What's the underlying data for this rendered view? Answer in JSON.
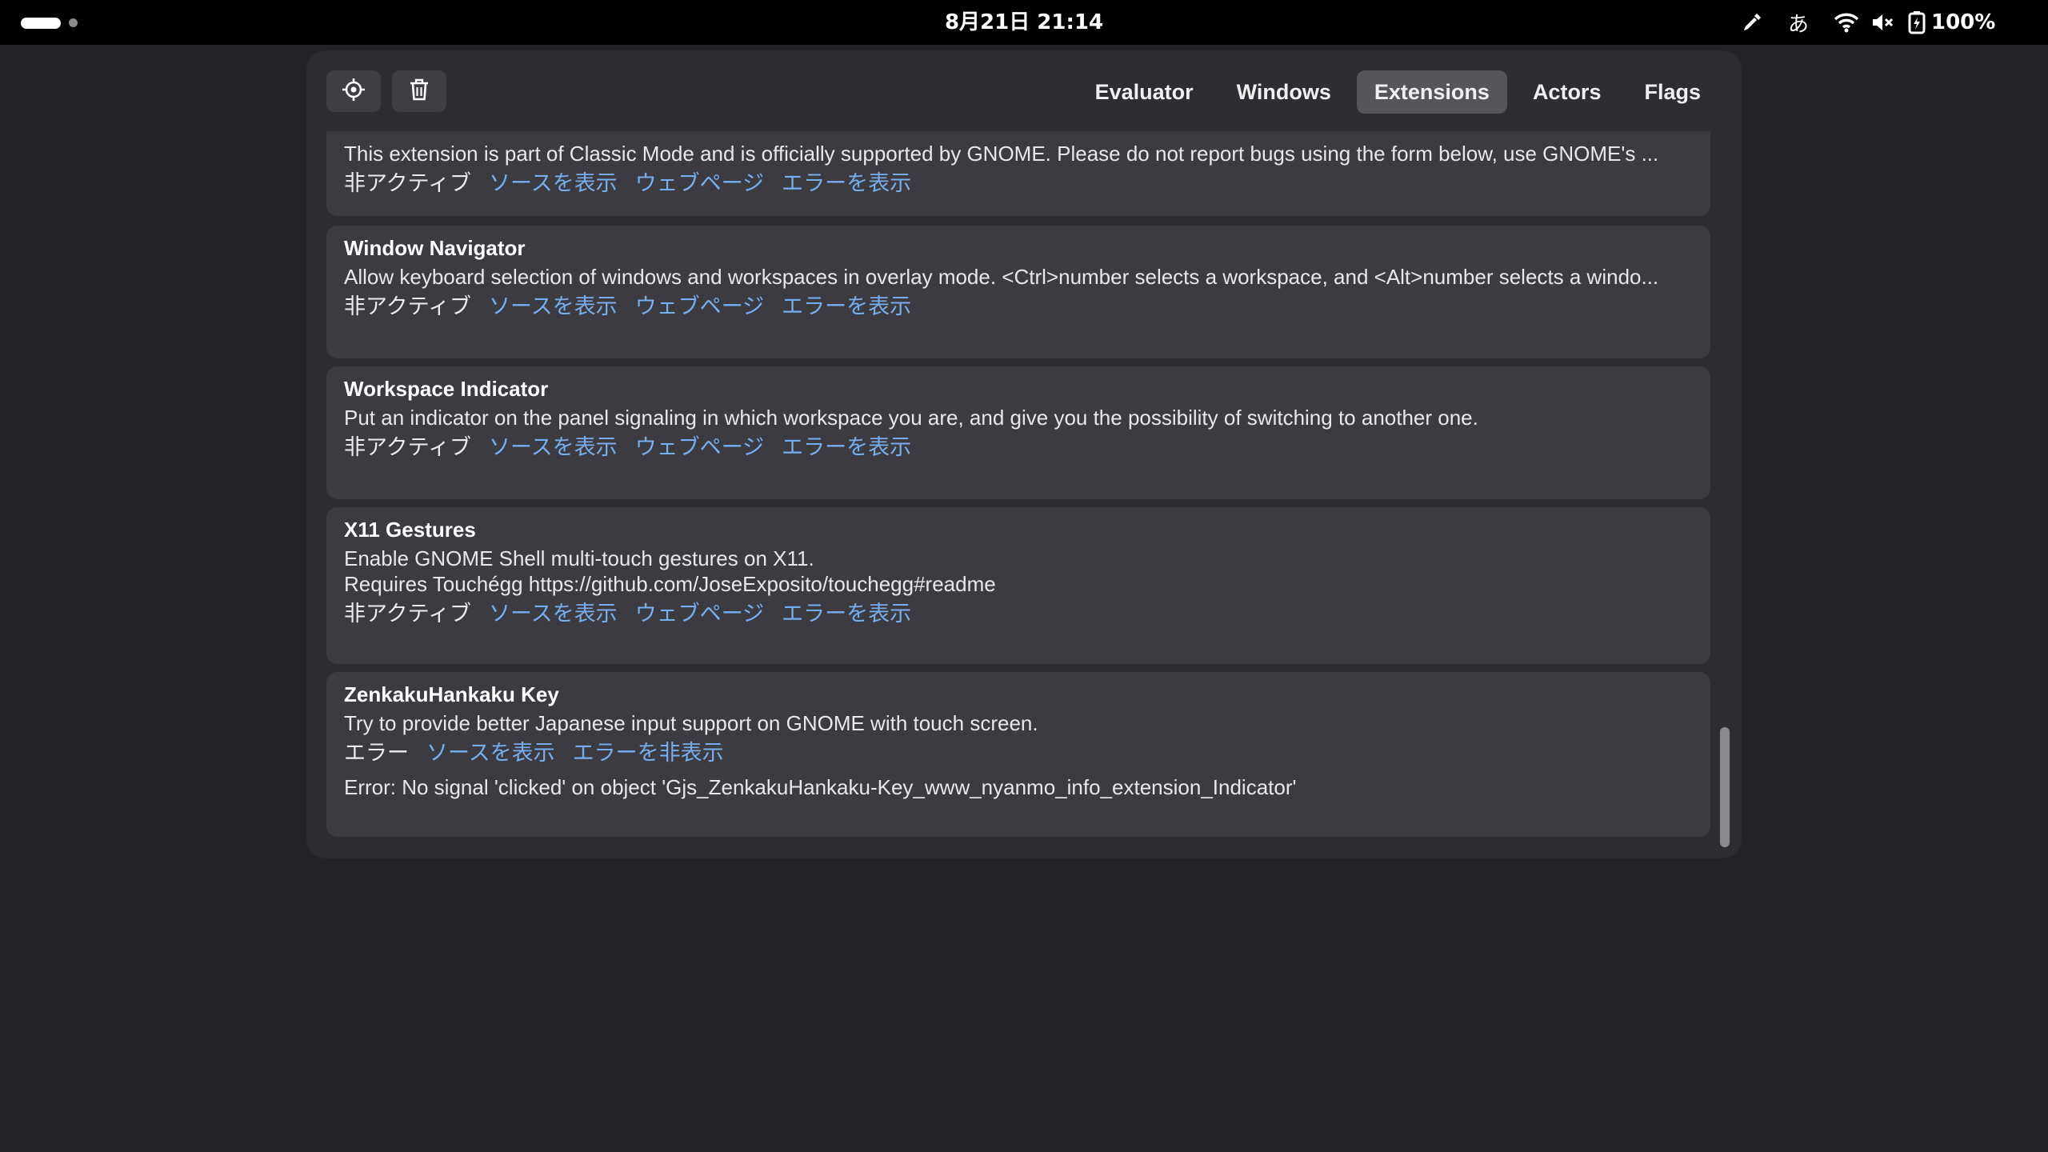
{
  "topbar": {
    "clock": "8月21日  21:14",
    "ime": "あ",
    "battery": "100%"
  },
  "toolbar": {
    "tabs": [
      "Evaluator",
      "Windows",
      "Extensions",
      "Actors",
      "Flags"
    ],
    "active_tab": "Extensions"
  },
  "extensions": [
    {
      "name": "",
      "description": "This extension is part of Classic Mode and is officially supported by GNOME. Please do not report bugs using the form below, use GNOME's ...",
      "state": "非アクティブ",
      "links": [
        "ソースを表示",
        "ウェブページ",
        "エラーを表示"
      ]
    },
    {
      "name": "Window Navigator",
      "description": "Allow keyboard selection of windows and workspaces in overlay mode. <Ctrl>number selects a workspace, and <Alt>number selects a windo...",
      "state": "非アクティブ",
      "links": [
        "ソースを表示",
        "ウェブページ",
        "エラーを表示"
      ]
    },
    {
      "name": "Workspace Indicator",
      "description": "Put an indicator on the panel signaling in which workspace you are, and give you the possibility of switching to another one.",
      "state": "非アクティブ",
      "links": [
        "ソースを表示",
        "ウェブページ",
        "エラーを表示"
      ]
    },
    {
      "name": "X11 Gestures",
      "description": "Enable GNOME Shell multi-touch gestures on X11.",
      "description2": "Requires Touchégg https://github.com/JoseExposito/touchegg#readme",
      "state": "非アクティブ",
      "links": [
        "ソースを表示",
        "ウェブページ",
        "エラーを表示"
      ]
    },
    {
      "name": "ZenkakuHankaku Key",
      "description": "Try to provide better Japanese input support on GNOME with touch screen.",
      "state": "エラー",
      "links": [
        "ソースを表示",
        "エラーを非表示"
      ],
      "error": "Error: No signal 'clicked' on object 'Gjs_ZenkakuHankaku-Key_www_nyanmo_info_extension_Indicator'"
    }
  ]
}
